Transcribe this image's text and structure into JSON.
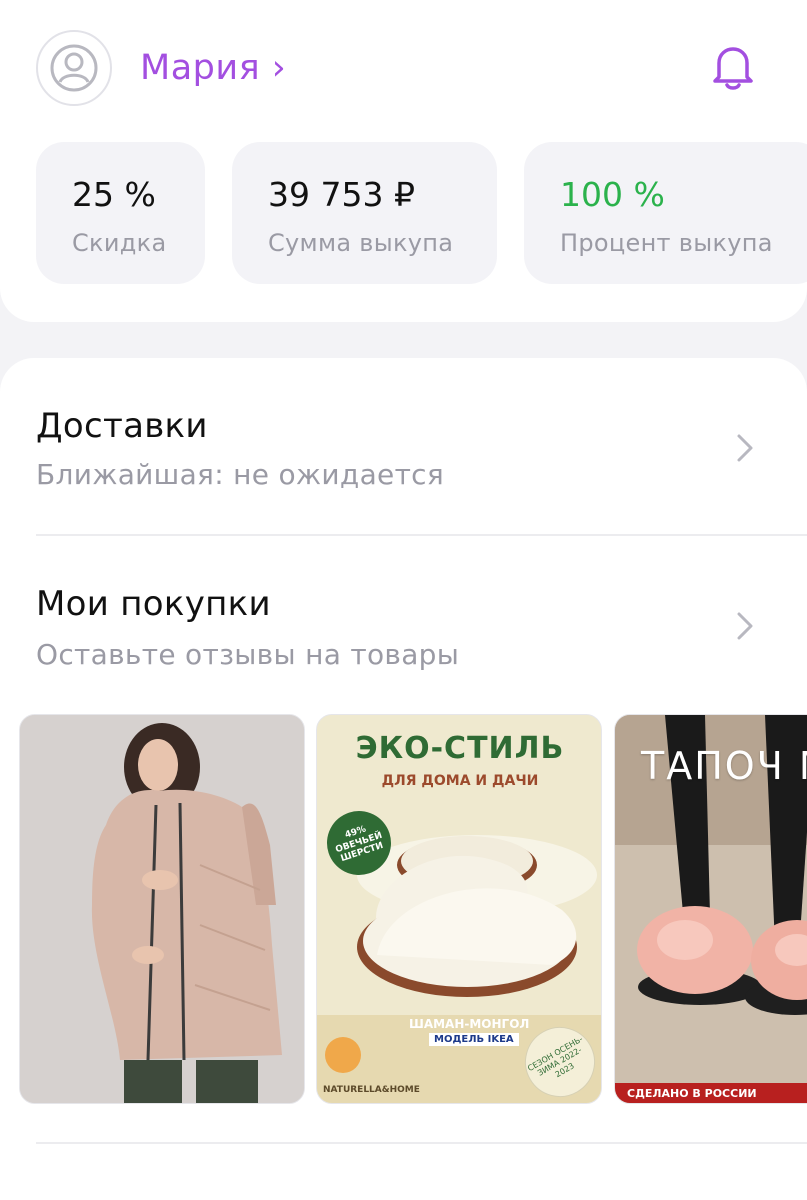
{
  "profile": {
    "name": "Мария ›",
    "accent_color": "#a34fe0"
  },
  "icons": [
    "user-avatar-icon",
    "bell-icon",
    "chevron-right-icon"
  ],
  "stats": [
    {
      "value": "25 %",
      "label": "Скидка"
    },
    {
      "value": "39 753 ₽",
      "label": "Сумма выкупа"
    },
    {
      "value": "100 %",
      "label": "Процент выкупа",
      "value_color": "#2bb24c"
    }
  ],
  "sections": {
    "deliveries": {
      "title": "Доставки",
      "subtitle": "Ближайшая: не ожидается"
    },
    "purchases": {
      "title": "Мои покупки",
      "subtitle": "Оставьте отзывы на товары"
    }
  },
  "products": {
    "slippers": {
      "title": "ЭКО-СТИЛЬ",
      "subtitle": "ДЛЯ ДОМА И ДАЧИ",
      "badge": "49% ОВЕЧЬЕЙ ШЕРСТИ",
      "model_name": "ШАМАН-МОНГОЛ",
      "model": "МОДЕЛЬ IKEA",
      "season": "СЕЗОН ОСЕНЬ-ЗИМА 2022-2023",
      "brand": "NATURELLA&HOME"
    },
    "fur_slippers": {
      "title": "ТАПОЧ МЕХОВ",
      "made_in": "СДЕЛАНО В РОССИИ"
    }
  }
}
